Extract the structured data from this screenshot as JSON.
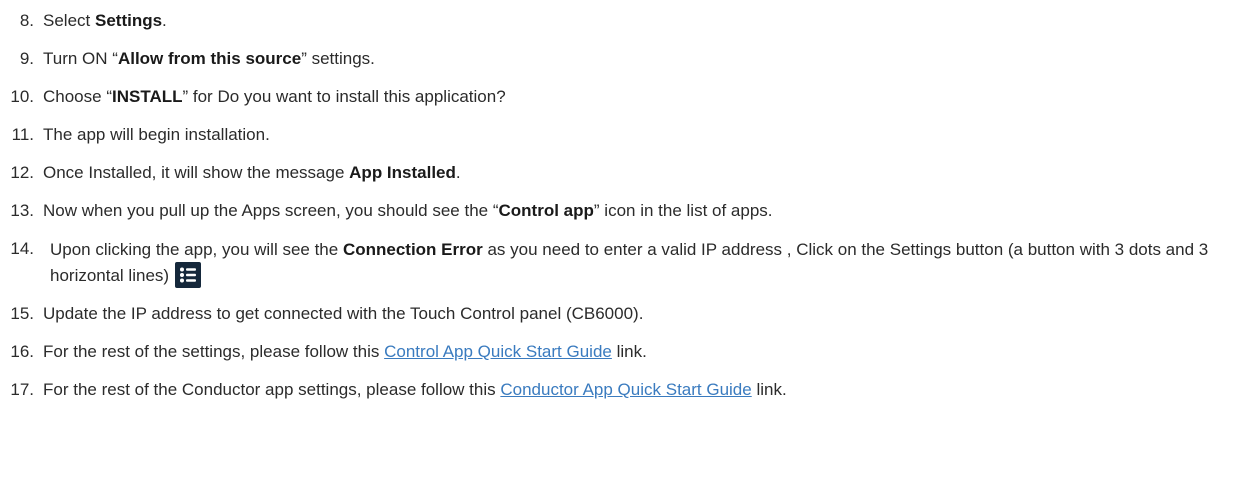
{
  "steps": [
    {
      "num": "8.",
      "pre": "Select ",
      "bold": "Settings",
      "post": "."
    },
    {
      "num": "9.",
      "pre": "Turn ON “",
      "bold": "Allow from this source",
      "post": "” settings."
    },
    {
      "num": "10.",
      "pre": "Choose “",
      "bold": "INSTALL",
      "post": "” for Do you want to install this application?"
    },
    {
      "num": "11.",
      "text": "The app will begin installation."
    },
    {
      "num": "12.",
      "pre": "Once Installed, it will show the message ",
      "bold": "App Installed",
      "post": "."
    },
    {
      "num": "13.",
      "pre": "Now when you pull up the Apps screen, you should see the “",
      "bold": "Control app",
      "post": "” icon in the list of apps."
    },
    {
      "num": "14.",
      "pre": "Upon clicking the app, you will see the ",
      "bold": "Connection Error",
      "post": " as you need to enter a valid IP address , Click on the Settings button (a button with 3 dots and 3 horizontal lines)",
      "icon": "list-settings-icon"
    },
    {
      "num": "15.",
      "text": "Update the IP address to get connected with the Touch Control panel (CB6000)."
    },
    {
      "num": "16.",
      "pre": "For the rest of the settings, please follow this ",
      "link": "Control App Quick Start Guide",
      "post": " link."
    },
    {
      "num": "17.",
      "pre": "For the rest of the Conductor app settings, please follow this ",
      "link": "Conductor App Quick Start Guide",
      "post": " link."
    }
  ],
  "colors": {
    "text": "#2b2b2b",
    "link": "#3a7bbf",
    "icon_bg": "#15283b",
    "icon_fg": "#ffffff"
  }
}
